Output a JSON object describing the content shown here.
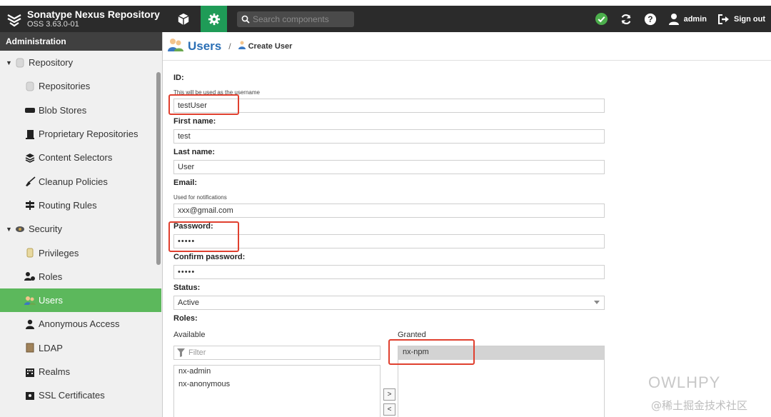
{
  "app": {
    "name": "Sonatype Nexus Repository",
    "version": "OSS 3.63.0-01"
  },
  "header": {
    "search_placeholder": "Search components",
    "user_label": "admin",
    "signout_label": "Sign out"
  },
  "sidebar": {
    "title": "Administration",
    "items": [
      {
        "label": "Repository",
        "icon": "database-icon"
      },
      {
        "label": "Repositories",
        "icon": "database-icon"
      },
      {
        "label": "Blob Stores",
        "icon": "drive-icon"
      },
      {
        "label": "Proprietary Repositories",
        "icon": "door-icon"
      },
      {
        "label": "Content Selectors",
        "icon": "layers-icon"
      },
      {
        "label": "Cleanup Policies",
        "icon": "broom-icon"
      },
      {
        "label": "Routing Rules",
        "icon": "signpost-icon"
      },
      {
        "label": "Security",
        "icon": "eye-icon"
      },
      {
        "label": "Privileges",
        "icon": "medal-icon"
      },
      {
        "label": "Roles",
        "icon": "users-icon"
      },
      {
        "label": "Users",
        "icon": "users-color-icon"
      },
      {
        "label": "Anonymous Access",
        "icon": "person-icon"
      },
      {
        "label": "LDAP",
        "icon": "book-icon"
      },
      {
        "label": "Realms",
        "icon": "building-icon"
      },
      {
        "label": "SSL Certificates",
        "icon": "certificate-icon"
      }
    ]
  },
  "breadcrumb": {
    "title": "Users",
    "separator": "/",
    "current": "Create User"
  },
  "form": {
    "id_label": "ID:",
    "id_hint": "This will be used as the username",
    "id_value": "testUser",
    "first_name_label": "First name:",
    "first_name_value": "test",
    "last_name_label": "Last name:",
    "last_name_value": "User",
    "email_label": "Email:",
    "email_hint": "Used for notifications",
    "email_value": "xxx@gmail.com",
    "password_label": "Password:",
    "password_value": "•••••",
    "confirm_label": "Confirm password:",
    "confirm_value": "•••••",
    "status_label": "Status:",
    "status_value": "Active",
    "roles_label": "Roles:",
    "available_label": "Available",
    "granted_label": "Granted",
    "filter_placeholder": "Filter",
    "available_roles": [
      "nx-admin",
      "nx-anonymous"
    ],
    "granted_roles": [
      "nx-npm"
    ],
    "move_right": ">",
    "move_left": "<"
  },
  "watermark": {
    "brand": "OWLHPY",
    "site": "@稀土掘金技术社区"
  },
  "colors": {
    "header_bg": "#2b2b2b",
    "gear_active": "#1f9b57",
    "sidebar_active": "#5cb85c",
    "highlight_box": "#e0402f",
    "link_blue": "#2a6fb5"
  }
}
